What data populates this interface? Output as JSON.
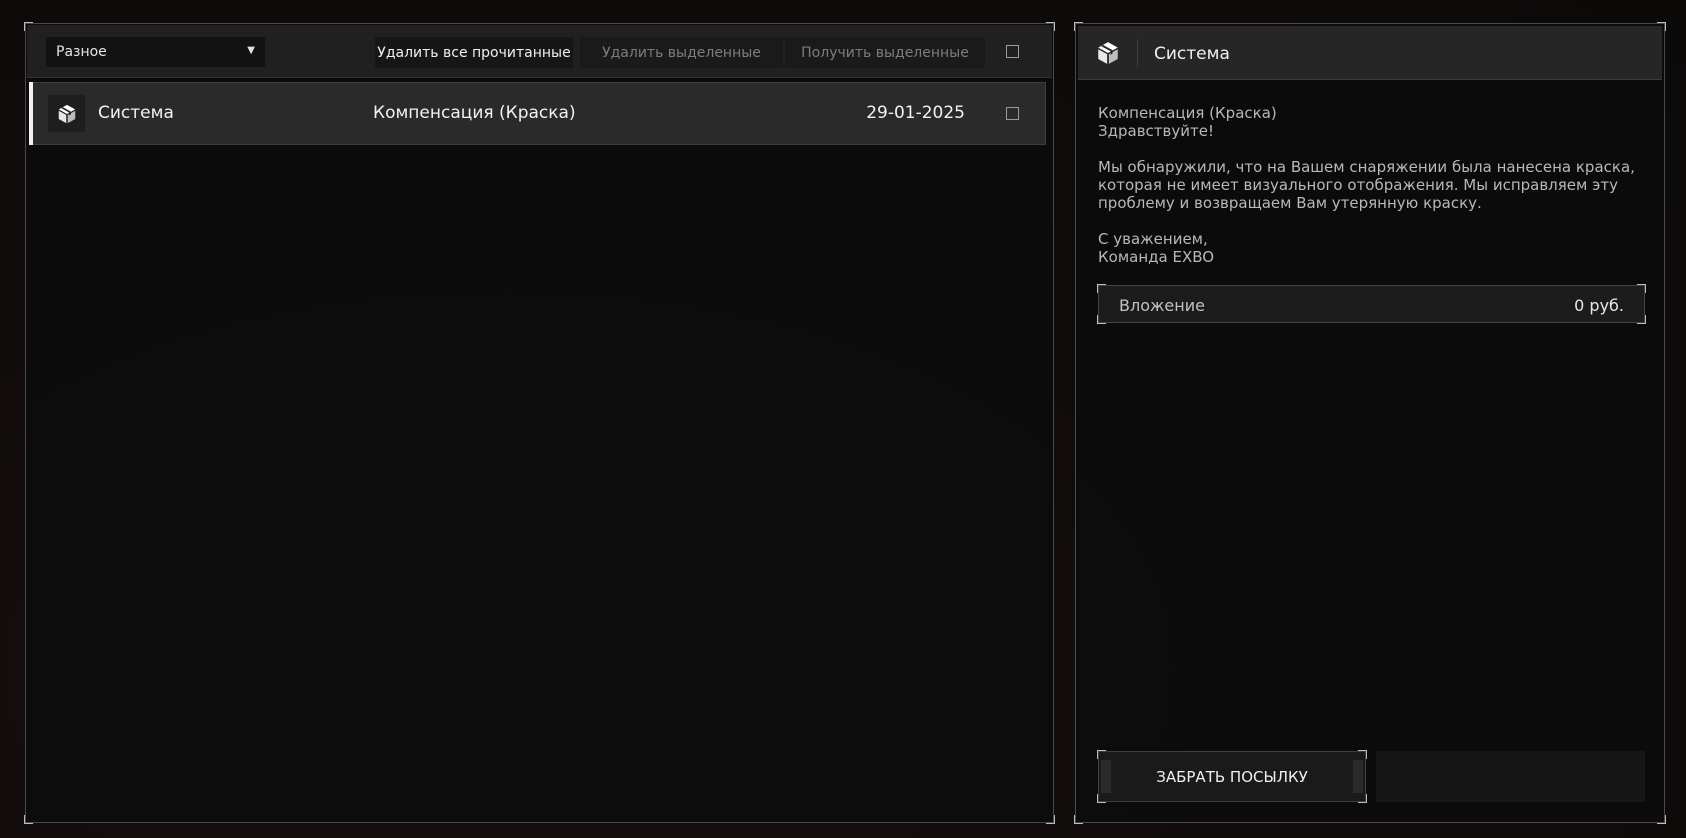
{
  "toolbar": {
    "category_select": "Разное",
    "delete_read_label": "Удалить все прочитанные",
    "delete_selected_label": "Удалить выделенные",
    "get_selected_label": "Получить выделенные"
  },
  "mail_list": [
    {
      "sender": "Система",
      "subject": "Компенсация (Краска)",
      "date": "29-01-2025",
      "selected": true
    }
  ],
  "detail": {
    "sender": "Система",
    "subject": "Компенсация (Краска)",
    "greeting": "Здравствуйте!",
    "body_line1": "Мы обнаружили, что на Вашем снаряжении была нанесена краска,",
    "body_line2": "которая не имеет визуального отображения. Мы исправляем эту",
    "body_line3": "проблему и возвращаем Вам утерянную краску.",
    "signoff": "С уважением,",
    "signature": "Команда EXBO",
    "attachment_label": "Вложение",
    "attachment_value": "0  руб.",
    "claim_label": "ЗАБРАТЬ ПОСЫЛКУ"
  },
  "icons": {
    "package": "package-icon",
    "dropdown": "chevron-down-icon"
  },
  "colors": {
    "background": "#0e0b0b",
    "panel_border": "#4a4a4a",
    "row_selected": "#2a2a2a",
    "selection_bar": "#f2f2f2"
  }
}
